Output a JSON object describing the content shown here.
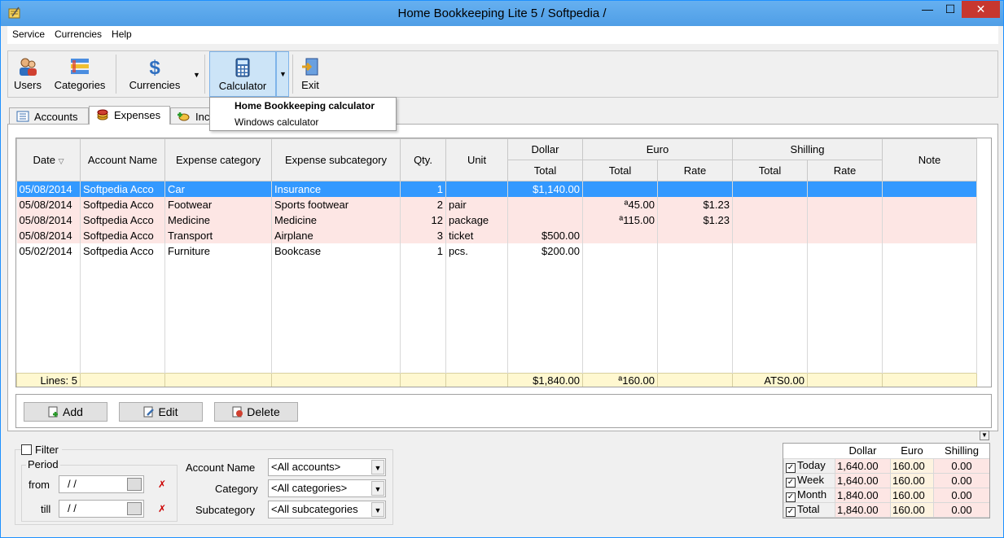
{
  "window": {
    "title": "Home Bookkeeping Lite 5  / Softpedia /",
    "min_label": "—",
    "max_label": "☐",
    "close_label": "✕"
  },
  "menu": [
    "Service",
    "Currencies",
    "Help"
  ],
  "toolbar": {
    "users": "Users",
    "categories": "Categories",
    "currencies": "Currencies",
    "calculator": "Calculator",
    "exit": "Exit"
  },
  "calculator_menu": {
    "items": [
      "Home Bookkeeping calculator",
      "Windows calculator"
    ]
  },
  "tabs": {
    "accounts": "Accounts",
    "expenses": "Expenses",
    "income": "Inc"
  },
  "grid": {
    "headers": {
      "date": "Date",
      "account_name": "Account Name",
      "expense_category": "Expense category",
      "expense_subcategory": "Expense subcategory",
      "qty": "Qty.",
      "unit": "Unit",
      "dollar": "Dollar",
      "euro": "Euro",
      "shilling": "Shilling",
      "note": "Note",
      "total": "Total",
      "rate": "Rate"
    },
    "rows": [
      {
        "date": "05/08/2014",
        "account": "Softpedia Acco",
        "category": "Car",
        "subcategory": "Insurance",
        "qty": "1",
        "unit": "",
        "dollar_total": "$1,140.00",
        "euro_total": "",
        "euro_rate": "",
        "shilling_total": "",
        "shilling_rate": "",
        "note": ""
      },
      {
        "date": "05/08/2014",
        "account": "Softpedia Acco",
        "category": "Footwear",
        "subcategory": "Sports footwear",
        "qty": "2",
        "unit": "pair",
        "dollar_total": "",
        "euro_total": "ª45.00",
        "euro_rate": "$1.23",
        "shilling_total": "",
        "shilling_rate": "",
        "note": ""
      },
      {
        "date": "05/08/2014",
        "account": "Softpedia Acco",
        "category": "Medicine",
        "subcategory": "Medicine",
        "qty": "12",
        "unit": "package",
        "dollar_total": "",
        "euro_total": "ª115.00",
        "euro_rate": "$1.23",
        "shilling_total": "",
        "shilling_rate": "",
        "note": ""
      },
      {
        "date": "05/08/2014",
        "account": "Softpedia Acco",
        "category": "Transport",
        "subcategory": "Airplane",
        "qty": "3",
        "unit": "ticket",
        "dollar_total": "$500.00",
        "euro_total": "",
        "euro_rate": "",
        "shilling_total": "",
        "shilling_rate": "",
        "note": ""
      },
      {
        "date": "05/02/2014",
        "account": "Softpedia Acco",
        "category": "Furniture",
        "subcategory": "Bookcase",
        "qty": "1",
        "unit": "pcs.",
        "dollar_total": "$200.00",
        "euro_total": "",
        "euro_rate": "",
        "shilling_total": "",
        "shilling_rate": "",
        "note": ""
      }
    ],
    "footer": {
      "lines": "Lines: 5",
      "dollar_total": "$1,840.00",
      "euro_total": "ª160.00",
      "shilling_total": "ATS0.00"
    }
  },
  "buttons": {
    "add": "Add",
    "edit": "Edit",
    "delete": "Delete"
  },
  "filter": {
    "label": "Filter",
    "period": "Period",
    "from": "from",
    "till": "till",
    "from_value": " /  /",
    "till_value": " /  /",
    "account_name_label": "Account Name",
    "category_label": "Category",
    "subcategory_label": "Subcategory",
    "account_name_value": "<All accounts>",
    "category_value": "<All categories>",
    "subcategory_value": "<All subcategories"
  },
  "summary": {
    "headers": [
      "Dollar",
      "Euro",
      "Shilling"
    ],
    "rows": [
      {
        "label": "Today",
        "dollar": "1,640.00",
        "euro": "160.00",
        "shilling": "0.00"
      },
      {
        "label": "Week",
        "dollar": "1,640.00",
        "euro": "160.00",
        "shilling": "0.00"
      },
      {
        "label": "Month",
        "dollar": "1,840.00",
        "euro": "160.00",
        "shilling": "0.00"
      },
      {
        "label": "Total",
        "dollar": "1,840.00",
        "euro": "160.00",
        "shilling": "0.00"
      }
    ]
  },
  "colors": {
    "titlebar": "#5aa5e6",
    "selected_row": "#3399ff",
    "pink_row": "#fde6e4",
    "footer_row": "#fff8d0",
    "close_button": "#c7372f"
  },
  "icons": {
    "app": "notebook-icon",
    "users": "users-icon",
    "categories": "categories-icon",
    "currencies": "dollar-icon",
    "calculator": "calculator-icon",
    "exit": "exit-icon"
  }
}
